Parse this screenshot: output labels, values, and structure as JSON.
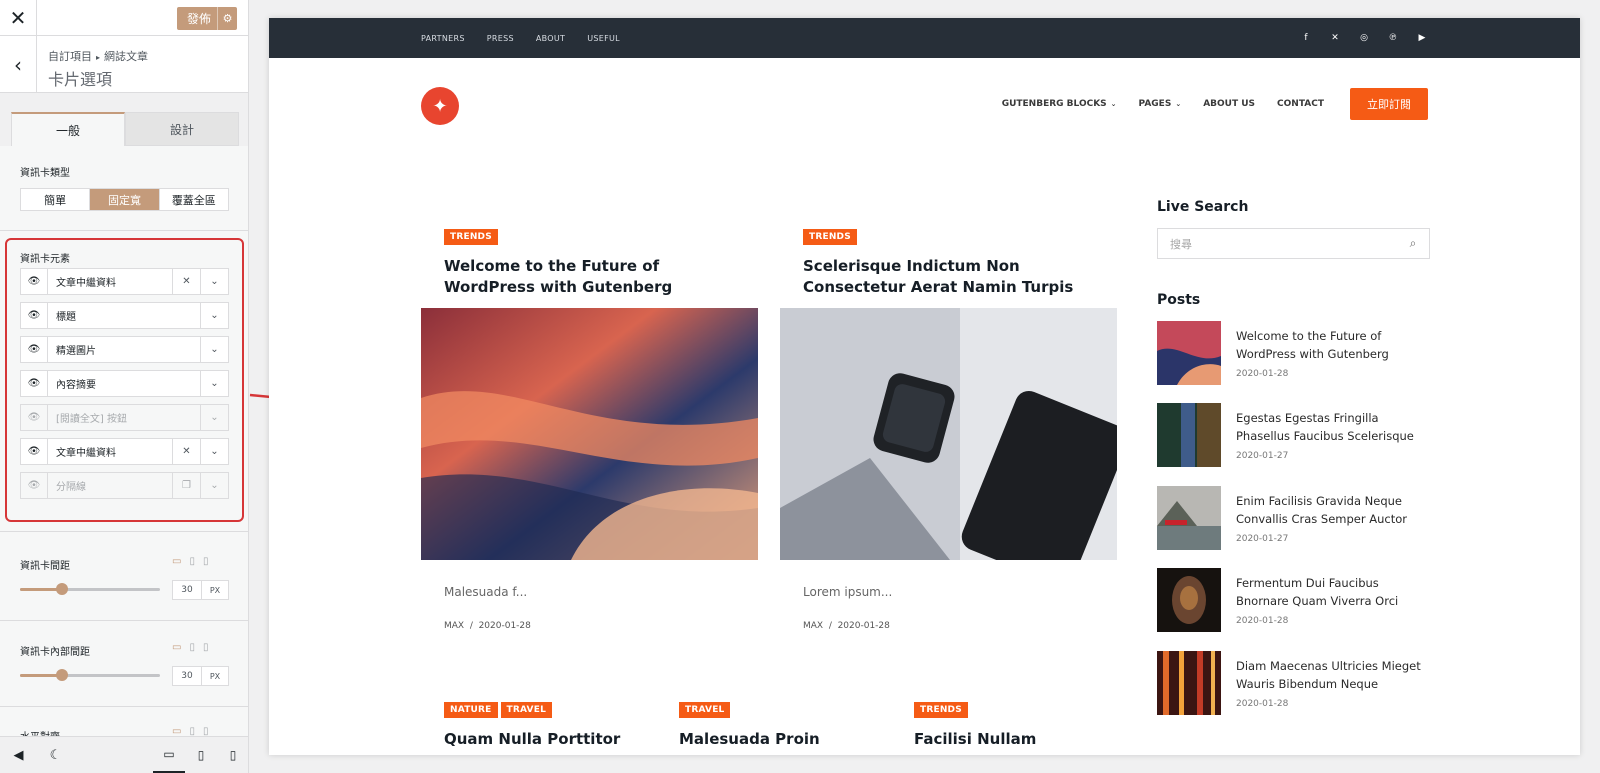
{
  "customizer": {
    "close_icon": "close-icon",
    "publish_label": "發佈",
    "settings_icon": "gear-icon",
    "back_icon": "chevron-left-icon",
    "breadcrumb": [
      "自訂項目",
      "網誌文章"
    ],
    "breadcrumb_separator": "▸",
    "section_title": "卡片選項",
    "tabs": [
      {
        "label": "一般",
        "active": true
      },
      {
        "label": "設計",
        "active": false
      }
    ],
    "card_type": {
      "label": "資訊卡類型",
      "options": [
        {
          "label": "簡單",
          "selected": false
        },
        {
          "label": "固定寬",
          "selected": true
        },
        {
          "label": "覆蓋全區",
          "selected": false
        }
      ]
    },
    "card_elements": {
      "label": "資訊卡元素",
      "items": [
        {
          "label": "文章中繼資料",
          "visible": true,
          "removable": true
        },
        {
          "label": "標題",
          "visible": true,
          "removable": false
        },
        {
          "label": "精選圖片",
          "visible": true,
          "removable": false
        },
        {
          "label": "內容摘要",
          "visible": true,
          "removable": false
        },
        {
          "label": "[閱讀全文] 按鈕",
          "visible": false,
          "removable": false
        },
        {
          "label": "文章中繼資料",
          "visible": true,
          "removable": true
        },
        {
          "label": "分隔線",
          "visible": false,
          "removable": false
        }
      ]
    },
    "card_spacing": {
      "label": "資訊卡間距",
      "value": "30",
      "unit": "PX",
      "fraction": 0.3
    },
    "card_inner_spacing": {
      "label": "資訊卡內部間距",
      "value": "30",
      "unit": "PX",
      "fraction": 0.3
    },
    "horizontal_align": {
      "label": "水平對齊"
    }
  },
  "preview": {
    "top_menu": [
      "PARTNERS",
      "PRESS",
      "ABOUT",
      "USEFUL"
    ],
    "social_icons": [
      "facebook-icon",
      "x-icon",
      "instagram-icon",
      "pinterest-icon",
      "youtube-icon"
    ],
    "main_menu": [
      {
        "label": "GUTENBERG BLOCKS",
        "dropdown": true
      },
      {
        "label": "PAGES",
        "dropdown": true
      },
      {
        "label": "ABOUT US",
        "dropdown": false
      },
      {
        "label": "CONTACT",
        "dropdown": false
      }
    ],
    "subscribe_label": "立即訂閱",
    "posts": [
      {
        "category": "TRENDS",
        "title": "Welcome to the Future of WordPress with Gutenberg",
        "excerpt": "Malesuada f...",
        "author": "MAX",
        "date": "2020-01-28"
      },
      {
        "category": "TRENDS",
        "title": "Scelerisque Indictum Non Consectetur Aerat Namin Turpis",
        "excerpt": "Lorem ipsum...",
        "author": "MAX",
        "date": "2020-01-28"
      }
    ],
    "row2": [
      {
        "categories": [
          "NATURE",
          "TRAVEL"
        ],
        "title": "Quam Nulla Porttitor"
      },
      {
        "categories": [
          "TRAVEL"
        ],
        "title": "Malesuada Proin"
      },
      {
        "categories": [
          "TRENDS"
        ],
        "title": "Facilisi Nullam"
      }
    ],
    "sidebar": {
      "search_title": "Live Search",
      "search_placeholder": "搜尋",
      "posts_title": "Posts",
      "posts": [
        {
          "title": "Welcome to the Future of WordPress with Gutenberg",
          "date": "2020-01-28"
        },
        {
          "title": "Egestas Egestas Fringilla Phasellus Faucibus Scelerisque",
          "date": "2020-01-27"
        },
        {
          "title": "Enim Facilisis Gravida Neque Convallis Cras Semper Auctor",
          "date": "2020-01-27"
        },
        {
          "title": "Fermentum Dui Faucibus Bnornare Quam Viverra Orci",
          "date": "2020-01-28"
        },
        {
          "title": "Diam Maecenas Ultricies Mieget Wauris Bibendum Neque",
          "date": "2020-01-28"
        }
      ]
    }
  },
  "colors": {
    "accent": "#c49b7b",
    "brand_orange": "#f55b15",
    "topbar": "#272f38",
    "highlight_box": "#d63638"
  }
}
